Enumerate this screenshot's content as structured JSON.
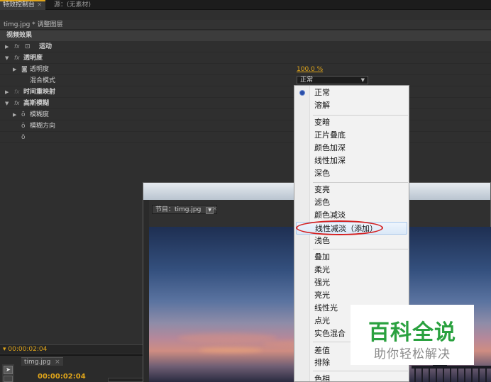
{
  "tabs": [
    {
      "label": "特效控制台",
      "close": "×"
    },
    {
      "label": "源：(无素材)"
    }
  ],
  "clip_header": "timg.jpg * 调整图层",
  "section_title": "视频效果",
  "effects": {
    "motion": "运动",
    "opacity": "透明度",
    "opacity_param": "透明度",
    "opacity_value": "100.0 %",
    "blend_mode_label": "混合模式",
    "blend_mode_value": "正常",
    "time_remap": "时间重映射",
    "gaussian_blur": "高斯模糊",
    "blurriness": "模糊度",
    "blur_dimensions": "模糊方向",
    "fx_symbol": "fx"
  },
  "timecode": "00:00:02:04",
  "sequence": {
    "tab": "timg.jpg",
    "close": "×",
    "time": "00:00:02:04"
  },
  "program_monitor": {
    "tab": "节目：timg.jpg",
    "dropdown": "▼",
    "close": "×"
  },
  "blend_menu": {
    "selected": "正常",
    "groups": [
      [
        "正常",
        "溶解"
      ],
      [
        "变暗",
        "正片叠底",
        "颜色加深",
        "线性加深",
        "深色"
      ],
      [
        "变亮",
        "滤色",
        "颜色减淡",
        "线性减淡（添加）",
        "浅色"
      ],
      [
        "叠加",
        "柔光",
        "强光",
        "亮光",
        "线性光",
        "点光",
        "实色混合"
      ],
      [
        "差值",
        "排除"
      ],
      [
        "色相"
      ]
    ],
    "highlighted": "线性减淡（添加）"
  },
  "watermark": {
    "title": "百科全说",
    "subtitle": "助你轻松解决"
  },
  "colors": {
    "accent": "#e0a51a",
    "highlight_circle": "#d41f1f",
    "watermark_green": "#2aa13f"
  },
  "icons": {
    "expand": "triangle-right-icon",
    "collapse": "triangle-down-icon",
    "stopwatch": "stopwatch-icon",
    "radio_selected": "radio-bullet-icon",
    "selection_tool": "arrow-cursor-icon"
  }
}
